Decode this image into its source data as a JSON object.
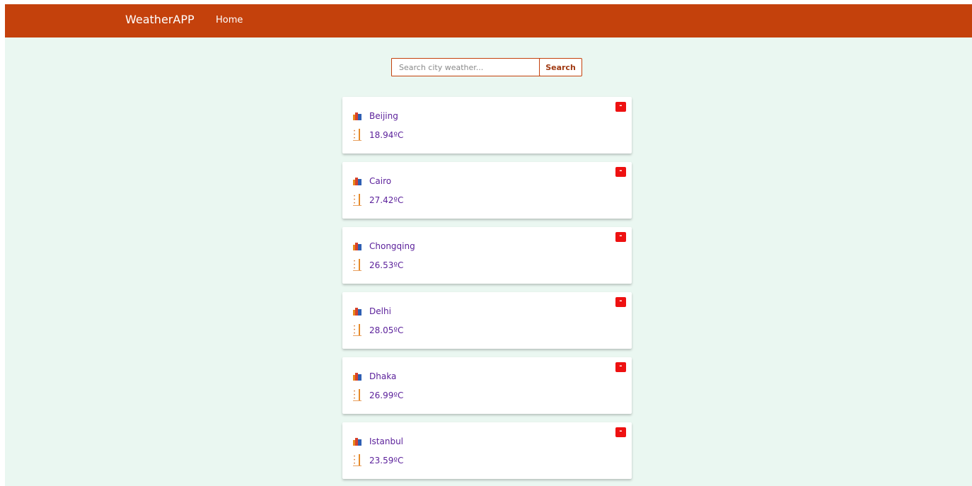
{
  "navbar": {
    "brand": "WeatherAPP",
    "home_label": "Home",
    "color": "#c4410c"
  },
  "search": {
    "placeholder": "Search city weather...",
    "value": "",
    "button_label": "Search"
  },
  "cities": [
    {
      "name": "Beijing",
      "temperature": "18.94ºC",
      "remove_label": "-"
    },
    {
      "name": "Cairo",
      "temperature": "27.42ºC",
      "remove_label": "-"
    },
    {
      "name": "Chongqing",
      "temperature": "26.53ºC",
      "remove_label": "-"
    },
    {
      "name": "Delhi",
      "temperature": "28.05ºC",
      "remove_label": "-"
    },
    {
      "name": "Dhaka",
      "temperature": "26.99ºC",
      "remove_label": "-"
    },
    {
      "name": "Istanbul",
      "temperature": "23.59ºC",
      "remove_label": "-"
    }
  ],
  "icons": {
    "city": "city-buildings-icon",
    "temperature": "thermometer-icon"
  },
  "colors": {
    "background": "#eaf7f1",
    "text": "#5a1f9a",
    "remove": "#ee1111"
  }
}
